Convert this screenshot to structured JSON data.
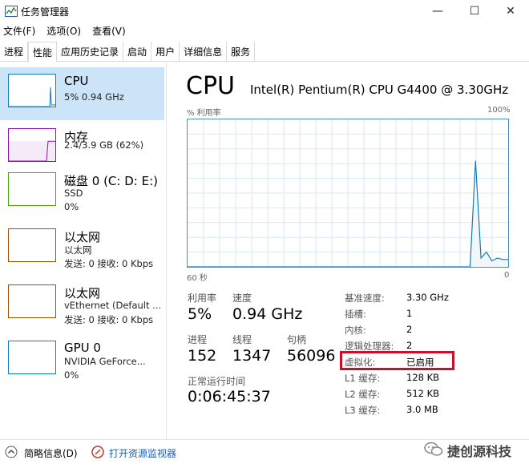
{
  "window": {
    "title": "任务管理器",
    "minimize": "—",
    "maximize": "☐",
    "close": "✕"
  },
  "menu": [
    "文件(F)",
    "选项(O)",
    "查看(V)"
  ],
  "tabs": [
    "进程",
    "性能",
    "应用历史记录",
    "启动",
    "用户",
    "详细信息",
    "服务"
  ],
  "active_tab": "性能",
  "sidebar": [
    {
      "title": "CPU",
      "lines": [
        "5% 0.94 GHz"
      ],
      "color": "#117dbb"
    },
    {
      "title": "内存",
      "lines": [
        "2.4/3.9 GB (62%)"
      ],
      "color": "#8b12ae"
    },
    {
      "title": "磁盘 0 (C: D: E:)",
      "lines": [
        "SSD",
        "0%"
      ],
      "color": "#4da60c"
    },
    {
      "title": "以太网",
      "lines": [
        "以太网",
        "发送: 0 接收: 0 Kbps"
      ],
      "color": "#a74f01"
    },
    {
      "title": "以太网",
      "lines": [
        "vEthernet (Default ...",
        "发送: 0 接收: 0 Kbps"
      ],
      "color": "#a74f01"
    },
    {
      "title": "GPU 0",
      "lines": [
        "NVIDIA GeForce...",
        "0%"
      ],
      "color": "#117dbb"
    }
  ],
  "main": {
    "title": "CPU",
    "model": "Intel(R) Pentium(R) CPU G4400 @ 3.30GHz",
    "graph_label": "% 利用率",
    "graph_max": "100%",
    "graph_time": "60 秒",
    "graph_zero": "0",
    "stats": {
      "util_label": "利用率",
      "util_value": "5%",
      "speed_label": "速度",
      "speed_value": "0.94 GHz",
      "proc_label": "进程",
      "proc_value": "152",
      "thread_label": "线程",
      "thread_value": "1347",
      "handle_label": "句柄",
      "handle_value": "56096",
      "uptime_label": "正常运行时间",
      "uptime_value": "0:06:45:37"
    },
    "specs": [
      {
        "label": "基准速度:",
        "value": "3.30 GHz"
      },
      {
        "label": "插槽:",
        "value": "1"
      },
      {
        "label": "内核:",
        "value": "2"
      },
      {
        "label": "逻辑处理器:",
        "value": "2"
      },
      {
        "label": "虚拟化:",
        "value": "已启用"
      },
      {
        "label": "L1 缓存:",
        "value": "128 KB"
      },
      {
        "label": "L2 缓存:",
        "value": "512 KB"
      },
      {
        "label": "L3 缓存:",
        "value": "3.0 MB"
      }
    ]
  },
  "footer": {
    "brief": "简略信息(D)",
    "monitor": "打开资源监视器"
  },
  "watermark": "捷创源科技",
  "cpu_history": [
    0,
    0,
    0,
    0,
    0,
    0,
    0,
    0,
    0,
    0,
    0,
    0,
    0,
    0,
    0,
    0,
    0,
    0,
    0,
    0,
    0,
    0,
    0,
    0,
    0,
    0,
    0,
    0,
    0,
    0,
    0,
    0,
    0,
    0,
    0,
    0,
    0,
    0,
    0,
    0,
    0,
    0,
    0,
    0,
    0,
    0,
    0,
    0,
    0,
    0,
    0,
    0,
    0,
    72,
    6,
    10,
    4,
    6,
    5,
    5
  ],
  "sidebar_thumbs": {
    "cpu": [
      0,
      0,
      0,
      0,
      0,
      0,
      0,
      0,
      0,
      0,
      0,
      0,
      0,
      0,
      0,
      0,
      0,
      0,
      0,
      0,
      0,
      0,
      0,
      0,
      0,
      0,
      0,
      0,
      0,
      0,
      0,
      0,
      0,
      0,
      0,
      0,
      0,
      0,
      0,
      0,
      0,
      0,
      0,
      0,
      0,
      0,
      0,
      0,
      0,
      0,
      0,
      0,
      0,
      60,
      5,
      5,
      5,
      5,
      5,
      5
    ],
    "memory_fill": 62
  }
}
